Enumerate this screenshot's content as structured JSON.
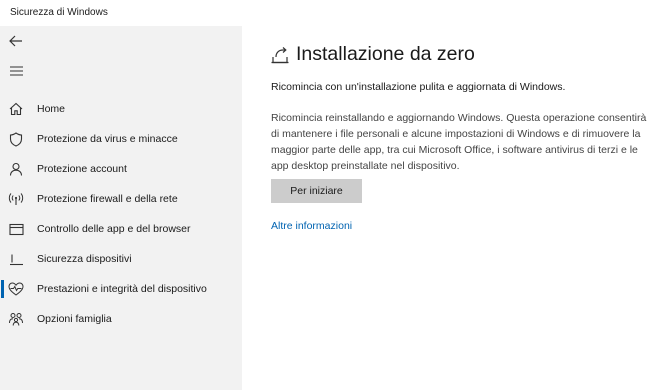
{
  "window": {
    "title": "Sicurezza di Windows"
  },
  "sidebar": {
    "back_icon": "back-arrow-icon",
    "menu_icon": "hamburger-menu-icon",
    "items": [
      {
        "label": "Home",
        "icon": "home-icon",
        "active": false
      },
      {
        "label": "Protezione da virus e minacce",
        "icon": "shield-icon",
        "active": false
      },
      {
        "label": "Protezione account",
        "icon": "person-icon",
        "active": false
      },
      {
        "label": "Protezione firewall e della rete",
        "icon": "wireless-antenna-icon",
        "active": false
      },
      {
        "label": "Controllo delle app e del browser",
        "icon": "app-window-icon",
        "active": false
      },
      {
        "label": "Sicurezza dispositivi",
        "icon": "laptop-icon",
        "active": false
      },
      {
        "label": "Prestazioni e integrità del dispositivo",
        "icon": "heart-pulse-icon",
        "active": true
      },
      {
        "label": "Opzioni famiglia",
        "icon": "family-icon",
        "active": false
      }
    ]
  },
  "main": {
    "title": "Installazione da zero",
    "title_icon": "fresh-start-icon",
    "subtitle": "Ricomincia con un'installazione pulita e aggiornata di Windows.",
    "description": "Ricomincia reinstallando e aggiornando Windows. Questa operazione consentirà di mantenere i file personali e alcune impostazioni di Windows e di rimuovere la maggior parte delle app, tra cui Microsoft Office, i software antivirus di terzi e le app desktop preinstallate nel dispositivo.",
    "start_button": "Per iniziare",
    "more_info_link": "Altre informazioni"
  },
  "colors": {
    "accent": "#0063b1",
    "sidebar_bg": "#f2f2f2",
    "button_bg": "#cccccc"
  }
}
